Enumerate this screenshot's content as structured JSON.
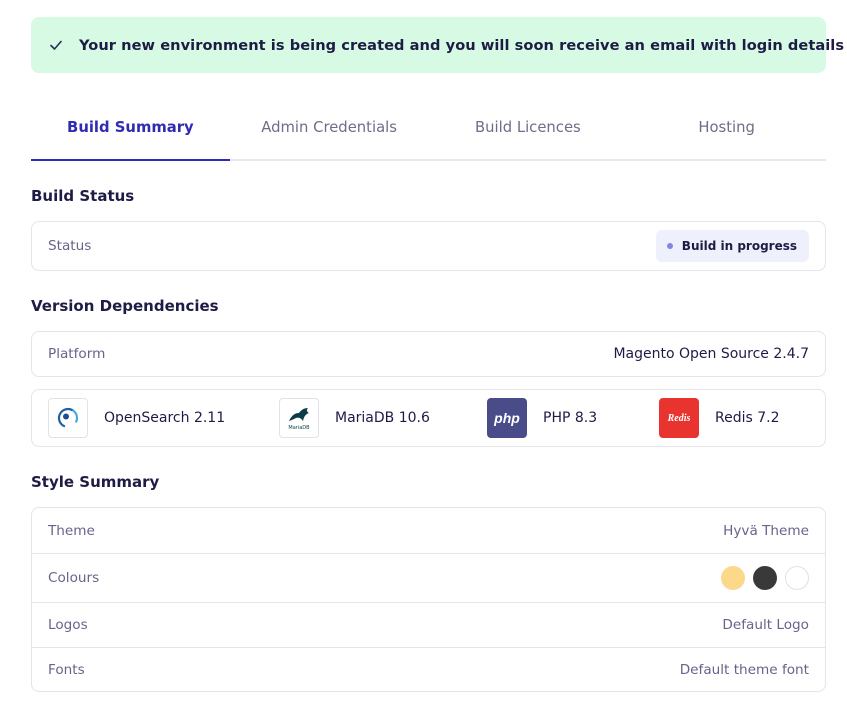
{
  "banner": {
    "message": "Your new environment is being created and you will soon receive an email with login details"
  },
  "tabs": [
    {
      "label": "Build Summary",
      "active": true
    },
    {
      "label": "Admin Credentials",
      "active": false
    },
    {
      "label": "Build Licences",
      "active": false
    },
    {
      "label": "Hosting",
      "active": false
    }
  ],
  "build_status": {
    "title": "Build Status",
    "status_label": "Status",
    "status_value": "Build in progress"
  },
  "version_dependencies": {
    "title": "Version Dependencies",
    "platform_label": "Platform",
    "platform_value": "Magento Open Source 2.4.7",
    "items": [
      {
        "name": "OpenSearch 2.11",
        "icon": "opensearch-logo-icon"
      },
      {
        "name": "MariaDB 10.6",
        "icon": "mariadb-logo-icon",
        "logo_text": "MariaDB"
      },
      {
        "name": "PHP 8.3",
        "icon": "php-logo-icon",
        "logo_text": "php"
      },
      {
        "name": "Redis 7.2",
        "icon": "redis-logo-icon",
        "logo_text": "Redis"
      }
    ]
  },
  "style_summary": {
    "title": "Style Summary",
    "rows": [
      {
        "label": "Theme",
        "value": "Hyvä Theme"
      },
      {
        "label": "Colours",
        "value": ""
      },
      {
        "label": "Logos",
        "value": "Default Logo"
      },
      {
        "label": "Fonts",
        "value": "Default theme font"
      }
    ],
    "colours": [
      "#fcd88a",
      "#393939",
      "#ffffff"
    ]
  },
  "colors": {
    "accent": "#2f2bb2",
    "banner_bg": "#d6fae4",
    "badge_dot": "#7f86e4"
  }
}
